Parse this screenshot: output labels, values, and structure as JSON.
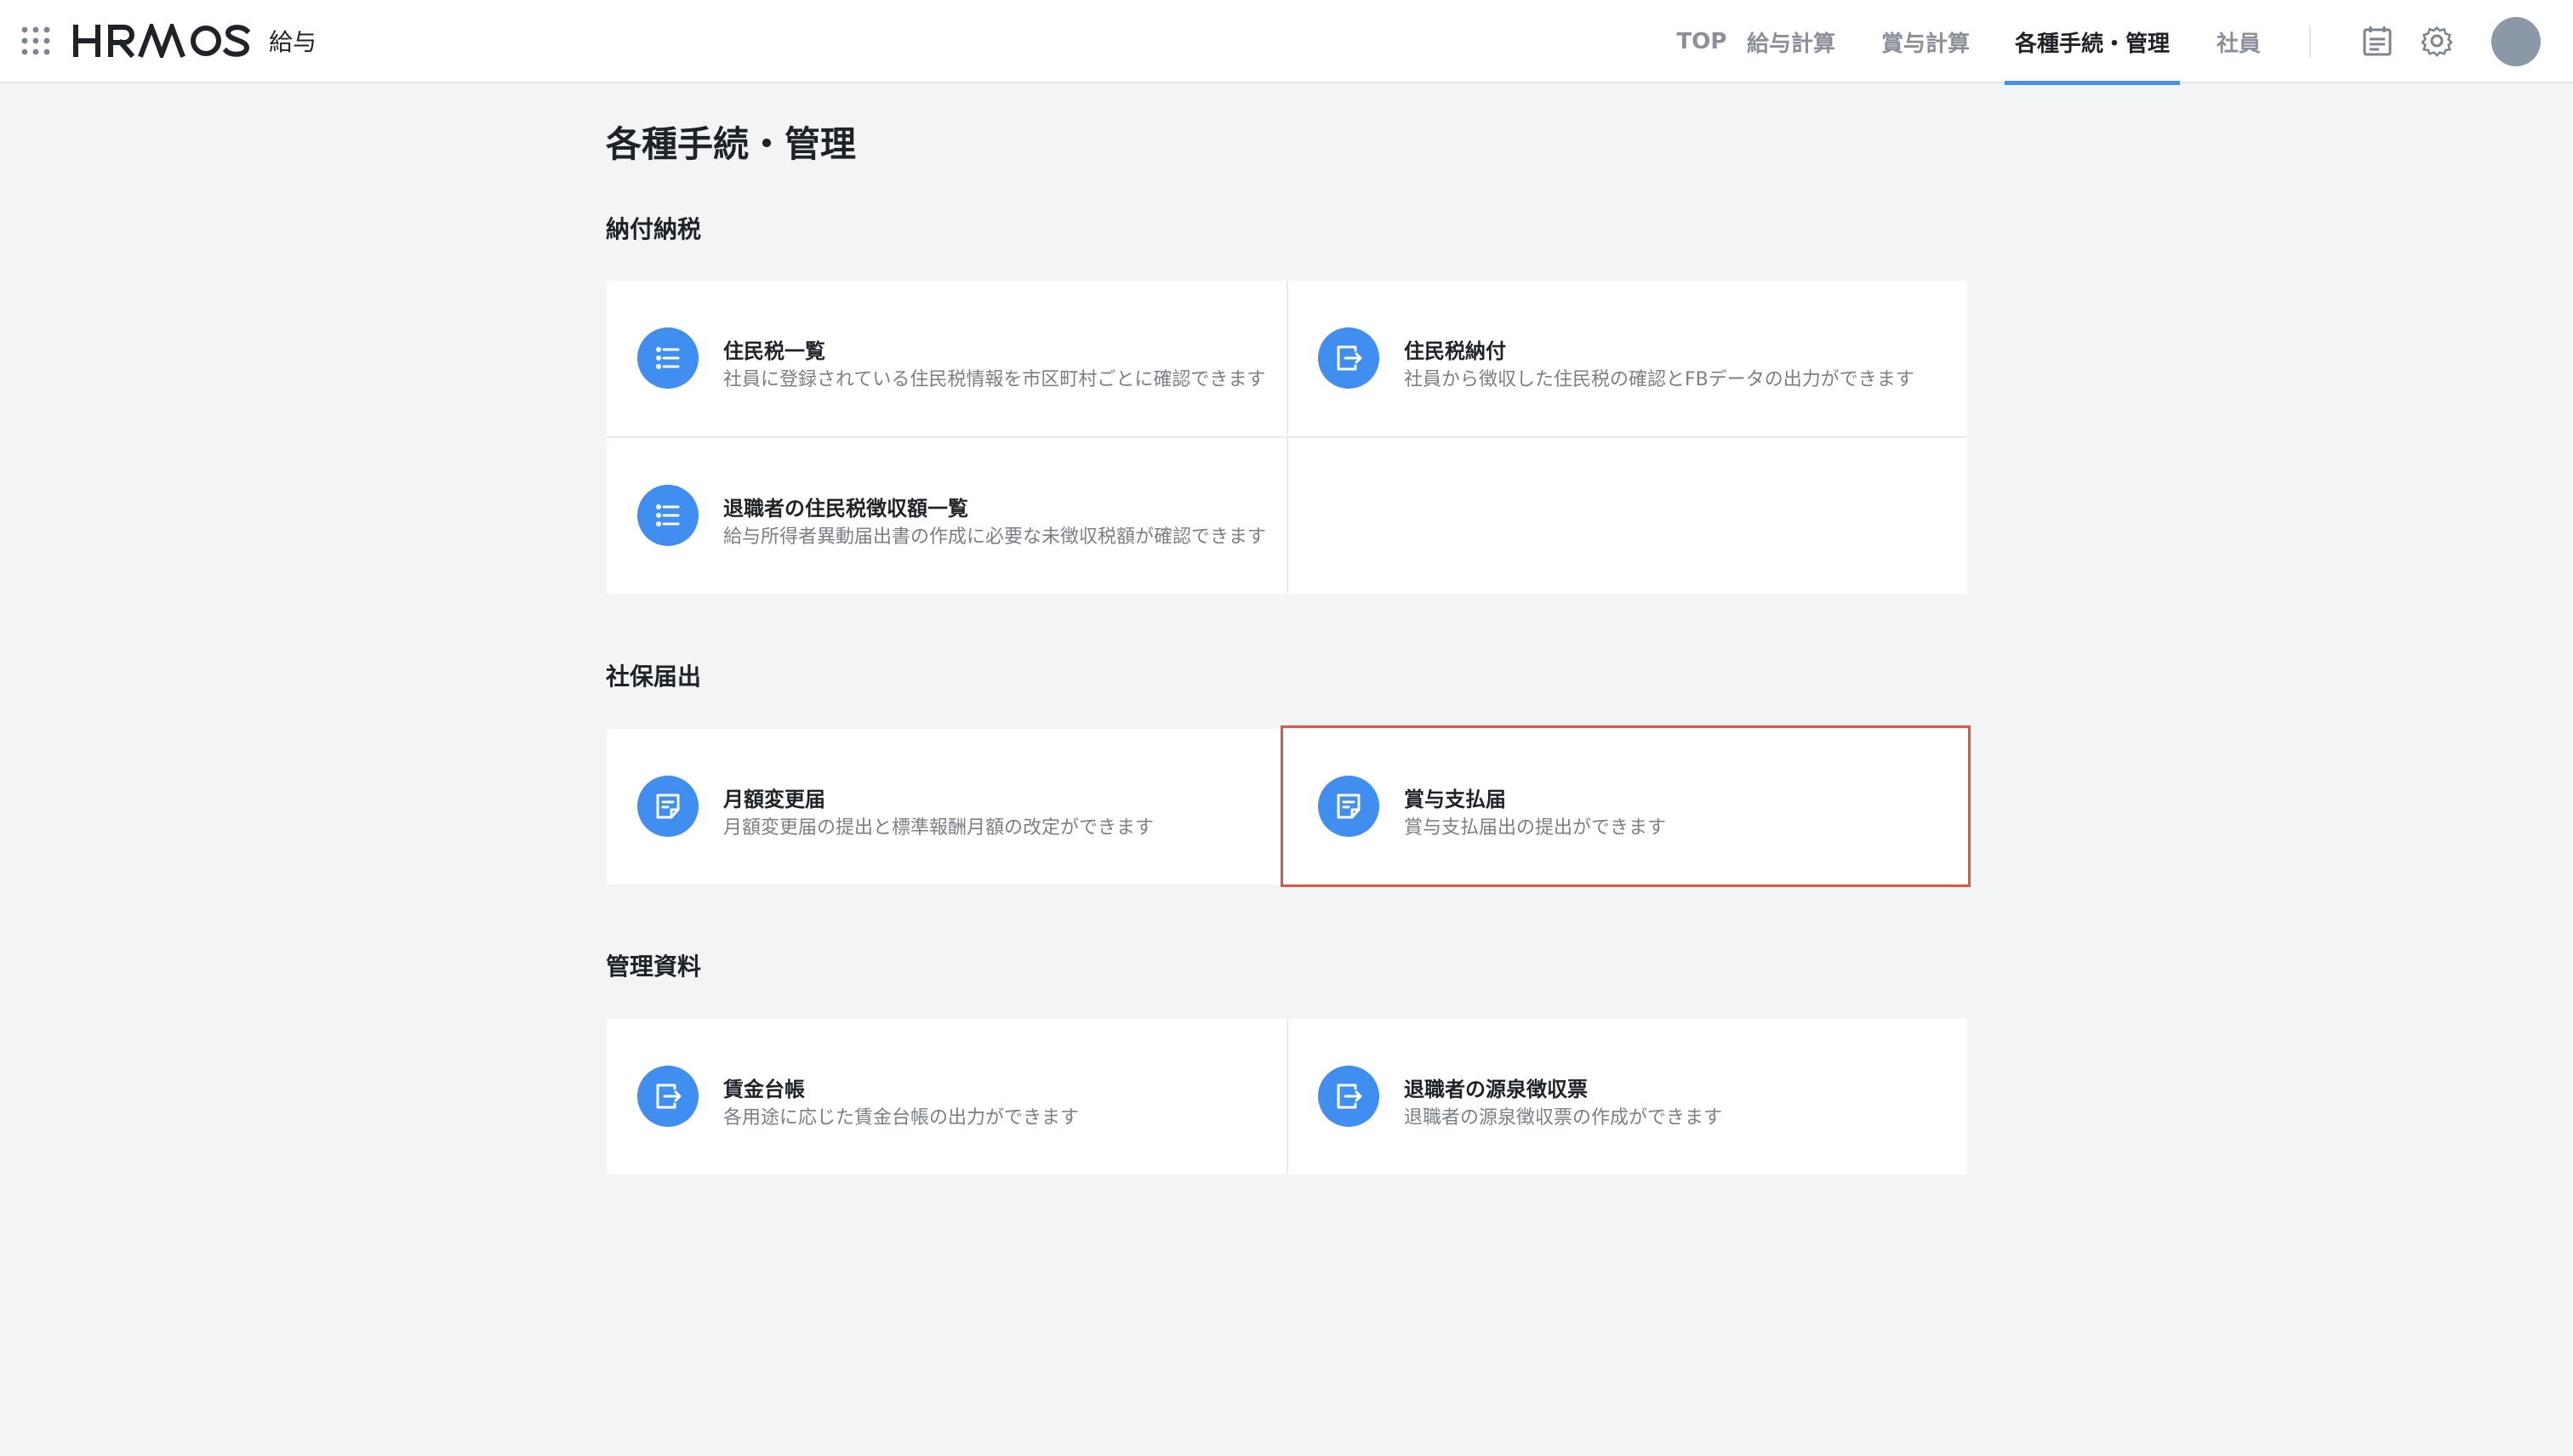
{
  "header": {
    "apps_icon": "grid-dots-icon",
    "logo_text": "HRMOS",
    "product_name": "給与",
    "nav": [
      {
        "label": "TOP",
        "active": false
      },
      {
        "label": "給与計算",
        "active": false
      },
      {
        "label": "賞与計算",
        "active": false
      },
      {
        "label": "各種手続・管理",
        "active": true
      },
      {
        "label": "社員",
        "active": false
      }
    ],
    "icons": [
      "calendar-icon",
      "gear-icon",
      "avatar"
    ],
    "accent_color": "#4a8ee6"
  },
  "page": {
    "title": "各種手続・管理"
  },
  "sections": [
    {
      "title": "納付納税",
      "cards": [
        {
          "icon": "list-icon",
          "title": "住民税一覧",
          "description": "社員に登録されている住民税情報を市区町村ごとに確認できます"
        },
        {
          "icon": "export-icon",
          "title": "住民税納付",
          "description": "社員から徴収した住民税の確認とFBデータの出力ができます"
        },
        {
          "icon": "list-icon",
          "title": "退職者の住民税徴収額一覧",
          "description": "給与所得者異動届出書の作成に必要な未徴収税額が確認できます"
        }
      ]
    },
    {
      "title": "社保届出",
      "cards": [
        {
          "icon": "document-icon",
          "title": "月額変更届",
          "description": "月額変更届の提出と標準報酬月額の改定ができます"
        },
        {
          "icon": "document-icon",
          "title": "賞与支払届",
          "description": "賞与支払届出の提出ができます",
          "highlighted": true
        }
      ]
    },
    {
      "title": "管理資料",
      "cards": [
        {
          "icon": "export-icon",
          "title": "賃金台帳",
          "description": "各用途に応じた賃金台帳の出力ができます"
        },
        {
          "icon": "export-icon",
          "title": "退職者の源泉徴収票",
          "description": "退職者の源泉徴収票の作成ができます"
        }
      ]
    }
  ],
  "colors": {
    "icon_circle": "#3f8ef0",
    "highlight_border": "#e2553f",
    "background": "#f3f4f6"
  }
}
